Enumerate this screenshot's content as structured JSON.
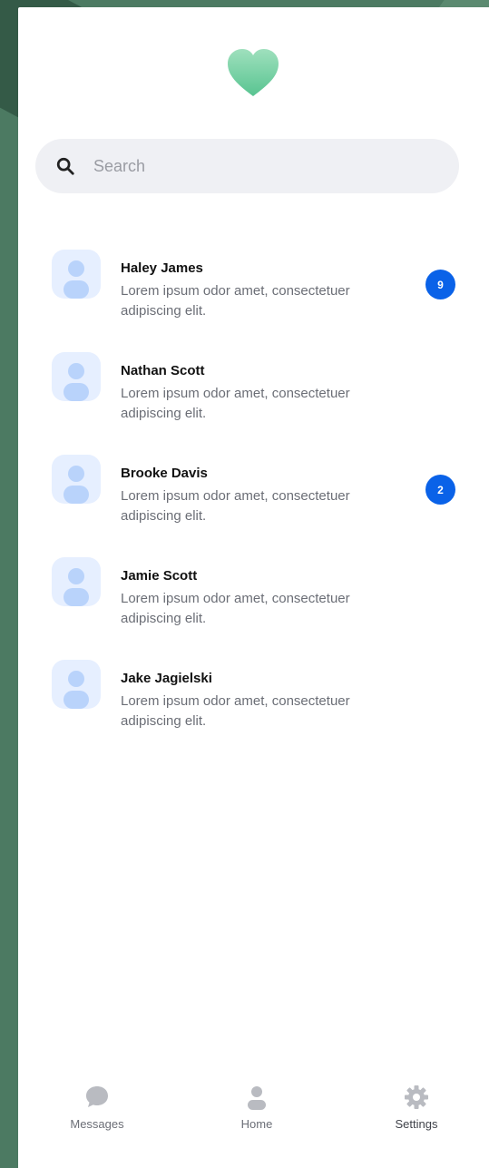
{
  "search": {
    "placeholder": "Search"
  },
  "chats": [
    {
      "name": "Haley James",
      "preview": "Lorem ipsum odor amet, consectetuer adipiscing elit.",
      "unread": "9"
    },
    {
      "name": "Nathan Scott",
      "preview": "Lorem ipsum odor amet, consectetuer adipiscing elit.",
      "unread": ""
    },
    {
      "name": "Brooke Davis",
      "preview": "Lorem ipsum odor amet, consectetuer adipiscing elit.",
      "unread": "2"
    },
    {
      "name": "Jamie Scott",
      "preview": "Lorem ipsum odor amet, consectetuer adipiscing elit.",
      "unread": ""
    },
    {
      "name": "Jake Jagielski",
      "preview": "Lorem ipsum odor amet, consectetuer adipiscing elit.",
      "unread": ""
    }
  ],
  "tabbar": {
    "messages": "Messages",
    "home": "Home",
    "settings": "Settings",
    "active": "settings"
  },
  "icons": {
    "logo": "heart-icon",
    "search": "search-icon",
    "avatar": "user-icon",
    "messages": "chat-bubble-icon",
    "home": "person-icon",
    "settings": "gear-icon"
  },
  "colors": {
    "accent": "#0a62e8",
    "logo_gradient": [
      "#a7e3c2",
      "#57c38f"
    ],
    "background": "#4c7a62"
  }
}
